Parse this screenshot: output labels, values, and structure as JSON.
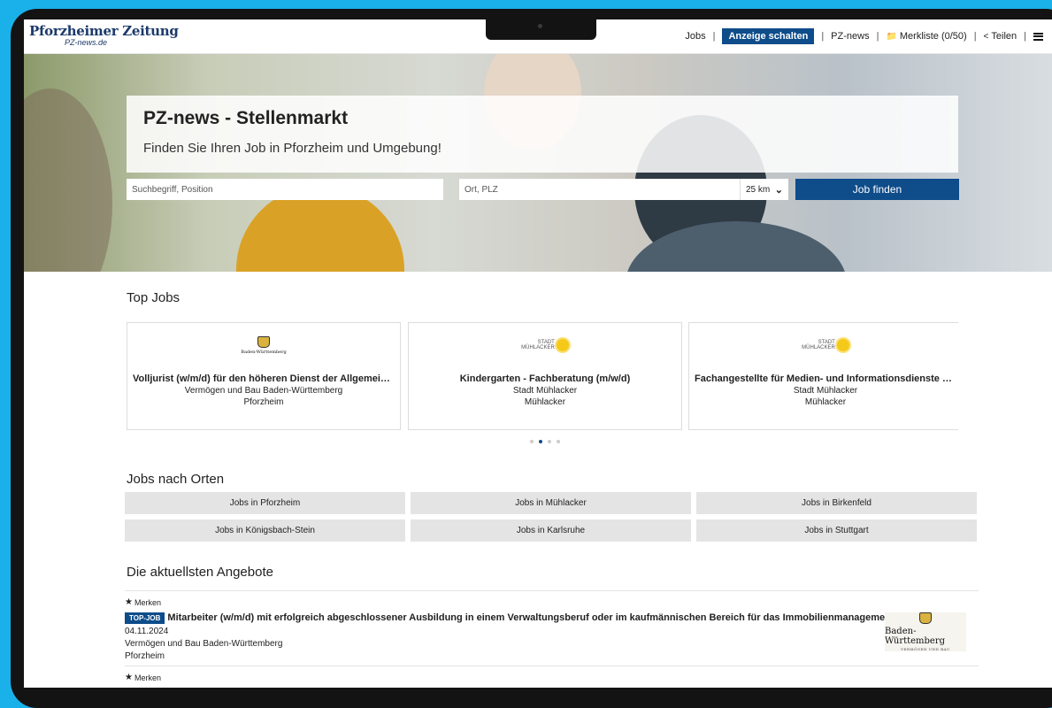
{
  "header": {
    "logo_main": "Pforzheimer Zeitung",
    "logo_sub": "PZ-news.de",
    "nav": {
      "jobs": "Jobs",
      "anzeige": "Anzeige schalten",
      "pznews": "PZ-news",
      "merkliste": "Merkliste (0/50)",
      "teilen": "Teilen"
    }
  },
  "hero": {
    "title": "PZ-news - Stellenmarkt",
    "subtitle": "Finden Sie Ihren Job in Pforzheim und Umgebung!",
    "search_placeholder": "Suchbegriff, Position",
    "location_placeholder": "Ort, PLZ",
    "radius": "25 km",
    "button": "Job finden"
  },
  "top_jobs": {
    "title": "Top Jobs",
    "cards": [
      {
        "logo": "Baden-Württemberg",
        "title": "Volljurist (w/m/d) für den höheren Dienst der Allgemeinen Finanzv...",
        "company": "Vermögen und Bau Baden-Württemberg",
        "location": "Pforzheim"
      },
      {
        "logo_top": "STADT",
        "logo_bottom": "MÜHLACKER",
        "title": "Kindergarten - Fachberatung (m/w/d)",
        "company": "Stadt Mühlacker",
        "location": "Mühlacker"
      },
      {
        "logo_top": "STADT",
        "logo_bottom": "MÜHLACKER",
        "title": "Fachangestellte für Medien- und Informationsdienste Fachrichtung...",
        "company": "Stadt Mühlacker",
        "location": "Mühlacker"
      }
    ]
  },
  "cities": {
    "title": "Jobs nach Orten",
    "items": [
      "Jobs in Pforzheim",
      "Jobs in Mühlacker",
      "Jobs in Birkenfeld",
      "Jobs in Königsbach-Stein",
      "Jobs in Karlsruhe",
      "Jobs in Stuttgart"
    ]
  },
  "offers": {
    "title": "Die aktuellsten Angebote",
    "items": [
      {
        "merken": "Merken",
        "badge": "TOP-JOB",
        "title": "Mitarbeiter (w/m/d) mit erfolgreich abgeschlossener Ausbildung in einem Verwaltungsberuf oder im kaufmännischen Bereich für das Immobilienmanagement",
        "date": "04.11.2024",
        "company": "Vermögen und Bau Baden-Württemberg",
        "location": "Pforzheim",
        "logo_name": "Baden-Württemberg",
        "logo_sub": "VERMÖGEN UND BAU"
      },
      {
        "merken": "Merken"
      }
    ]
  },
  "colors": {
    "primary": "#0e4c8a",
    "background": "#1ab0ea",
    "device": "#131313"
  }
}
